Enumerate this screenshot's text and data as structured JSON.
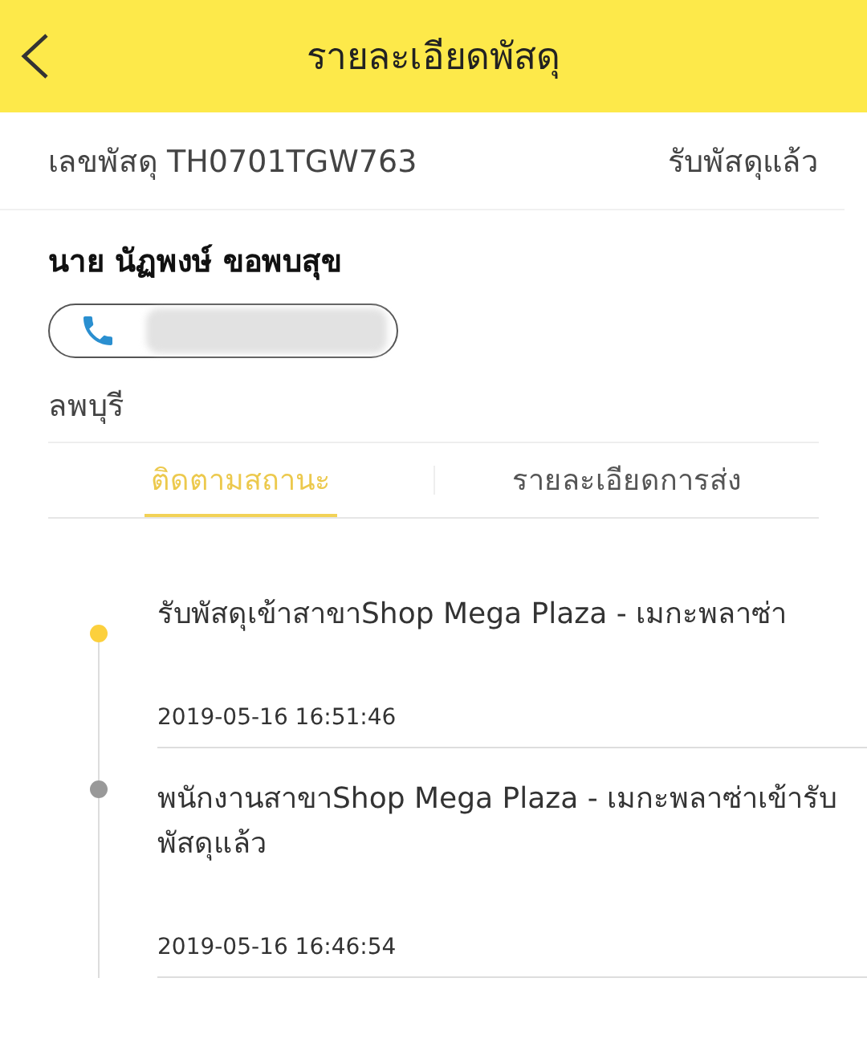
{
  "header": {
    "title": "รายละเอียดพัสดุ"
  },
  "parcel": {
    "number_label": "เลขพัสดุ TH0701TGW763",
    "status": "รับพัสดุแล้ว"
  },
  "recipient": {
    "name": "นาย นัฏพงษ์ ขอพบสุข",
    "phone_redacted": true,
    "province": "ลพบุรี"
  },
  "tabs": [
    {
      "label": "ติดตามสถานะ",
      "selected": true
    },
    {
      "label": "รายละเอียดการส่ง",
      "selected": false
    }
  ],
  "events": [
    {
      "text": "รับพัสดุเข้าสาขาShop Mega Plaza - เมกะพลาซ่า",
      "time": "2019-05-16 16:51:46",
      "current": true
    },
    {
      "text": "พนักงานสาขาShop Mega Plaza - เมกะพลาซ่าเข้ารับพัสดุแล้ว",
      "time": "2019-05-16 16:46:54",
      "current": false
    }
  ]
}
